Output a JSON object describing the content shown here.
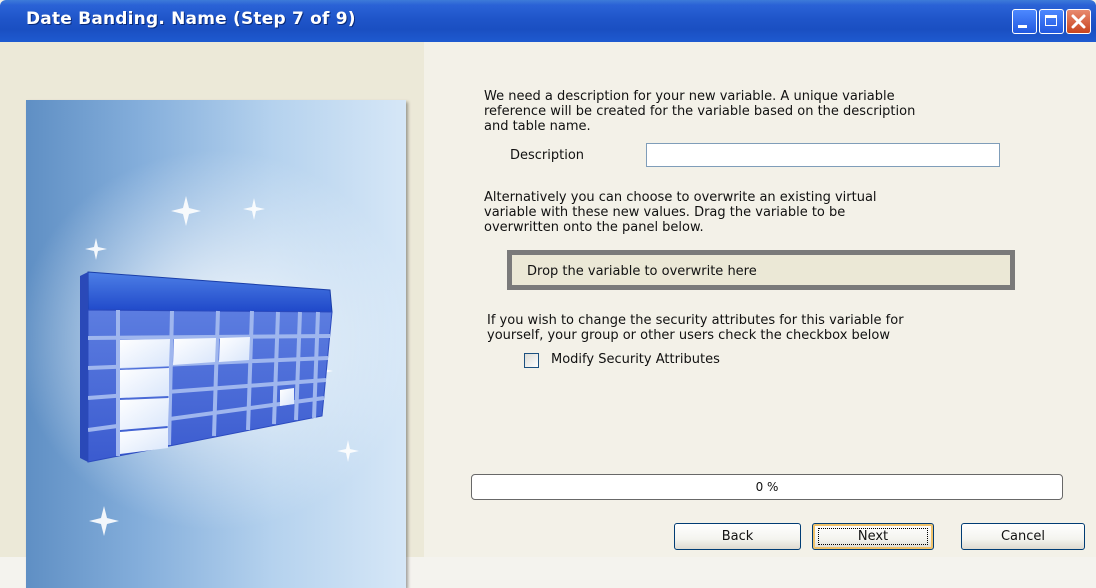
{
  "window": {
    "title": "Date Banding.  Name (Step 7 of 9)"
  },
  "intro": {
    "line1": "We need a description for your new variable.  A unique variable",
    "line2": "reference will be created for the variable based on the description",
    "line3": "and table name."
  },
  "description": {
    "label": "Description",
    "value": ""
  },
  "overwrite": {
    "line1": "Alternatively you can choose to overwrite an existing virtual",
    "line2": "variable with these new values. Drag the variable to be",
    "line3": "overwritten onto the panel below.",
    "drop_text": "Drop the variable to overwrite here"
  },
  "security": {
    "line1": "If you wish to change the security attributes for this variable for",
    "line2": "yourself, your group or other users check the checkbox below",
    "checkbox_label": "Modify Security Attributes",
    "checked": false
  },
  "progress": {
    "value": 0,
    "label": "0 %"
  },
  "buttons": {
    "back": "Back",
    "next": "Next",
    "cancel": "Cancel"
  },
  "icons": {
    "minimize": "minimize-icon",
    "maximize": "maximize-icon",
    "close": "close-icon",
    "illustration": "table-illustration"
  }
}
